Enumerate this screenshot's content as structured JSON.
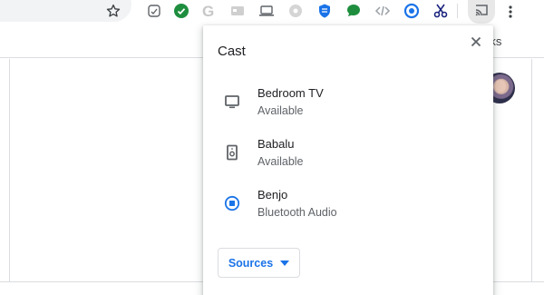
{
  "toolbar": {
    "star_icon": "star-outline-icon",
    "extensions": [
      {
        "name": "sparkle-extension-icon",
        "color": "#5f6368"
      },
      {
        "name": "check-shield-extension-icon",
        "color": "#1e8e3e"
      },
      {
        "name": "g-extension-icon",
        "color": "#bdbdbd"
      },
      {
        "name": "window-extension-icon",
        "color": "#9aa0a6"
      },
      {
        "name": "laptop-extension-icon",
        "color": "#5f6368"
      },
      {
        "name": "gear-extension-icon",
        "color": "#bdbdbd"
      },
      {
        "name": "shield-extension-icon",
        "color": "#1a73e8"
      },
      {
        "name": "chat-bubble-extension-icon",
        "color": "#1e8e3e"
      },
      {
        "name": "code-extension-icon",
        "color": "#9aa0a6"
      },
      {
        "name": "circle-extension-icon",
        "color": "#1a73e8"
      },
      {
        "name": "scissors-extension-icon",
        "color": "#1a237e"
      }
    ],
    "cast_icon": "cast-icon",
    "menu_icon": "more-vert-icon"
  },
  "bookmarks": {
    "label": "rks"
  },
  "cast_dialog": {
    "title": "Cast",
    "close_icon": "close-icon",
    "sinks": [
      {
        "name": "Bedroom TV",
        "status": "Available",
        "icon": "tv-icon"
      },
      {
        "name": "Babalu",
        "status": "Available",
        "icon": "speaker-icon"
      },
      {
        "name": "Benjo",
        "status": "Bluetooth Audio",
        "icon": "active-cast-icon"
      }
    ],
    "sources_label": "Sources"
  },
  "colors": {
    "accent": "#1a73e8",
    "text_primary": "#202124",
    "text_secondary": "#5f6368"
  }
}
